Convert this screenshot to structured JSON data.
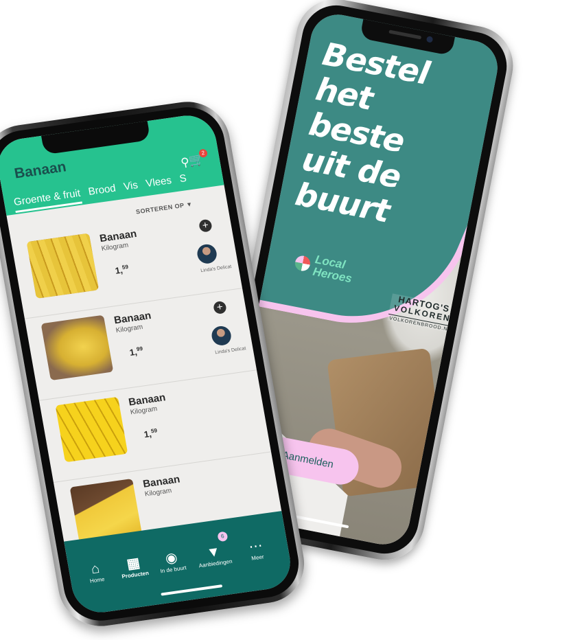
{
  "right_phone": {
    "headline": [
      "Bestel",
      "het",
      "beste",
      "uit de",
      "buurt"
    ],
    "brand": {
      "line1": "Local",
      "line2": "Heroes"
    },
    "sponsor": {
      "name": "HARTOG'S",
      "product": "VOLKOREN",
      "url": "VOLKORENBROOD.NL"
    },
    "signup_button": "Aanmelden",
    "colors": {
      "teal": "#3d8a84",
      "pink": "#f7c4ee"
    }
  },
  "left_phone": {
    "title": "Banaan",
    "cart_count": "2",
    "tabs": [
      "Groente & fruit",
      "Brood",
      "Vis",
      "Vlees",
      "S"
    ],
    "sort_label": "SORTEREN OP ▼",
    "products": [
      {
        "name": "Banaan",
        "unit": "Kilogram",
        "price_main": "1,",
        "price_cents": "59",
        "seller": "Linda's Delicat",
        "has_seller": true
      },
      {
        "name": "Banaan",
        "unit": "Kilogram",
        "price_main": "1,",
        "price_cents": "99",
        "seller": "Linda's Delicat",
        "has_seller": true
      },
      {
        "name": "Banaan",
        "unit": "Kilogram",
        "price_main": "1,",
        "price_cents": "59",
        "seller": "",
        "has_seller": false
      },
      {
        "name": "Banaan",
        "unit": "Kilogram",
        "price_main": "",
        "price_cents": "",
        "seller": "",
        "has_seller": false
      }
    ],
    "nav": [
      {
        "label": "Home",
        "icon": "home-icon"
      },
      {
        "label": "Producten",
        "icon": "basket-icon"
      },
      {
        "label": "In de buurt",
        "icon": "location-icon"
      },
      {
        "label": "Aanbiedingen",
        "icon": "tag-icon"
      },
      {
        "label": "Meer",
        "icon": "more-icon"
      }
    ],
    "offers_badge": "6",
    "colors": {
      "header": "#26c28f",
      "nav": "#0f6a64"
    }
  }
}
